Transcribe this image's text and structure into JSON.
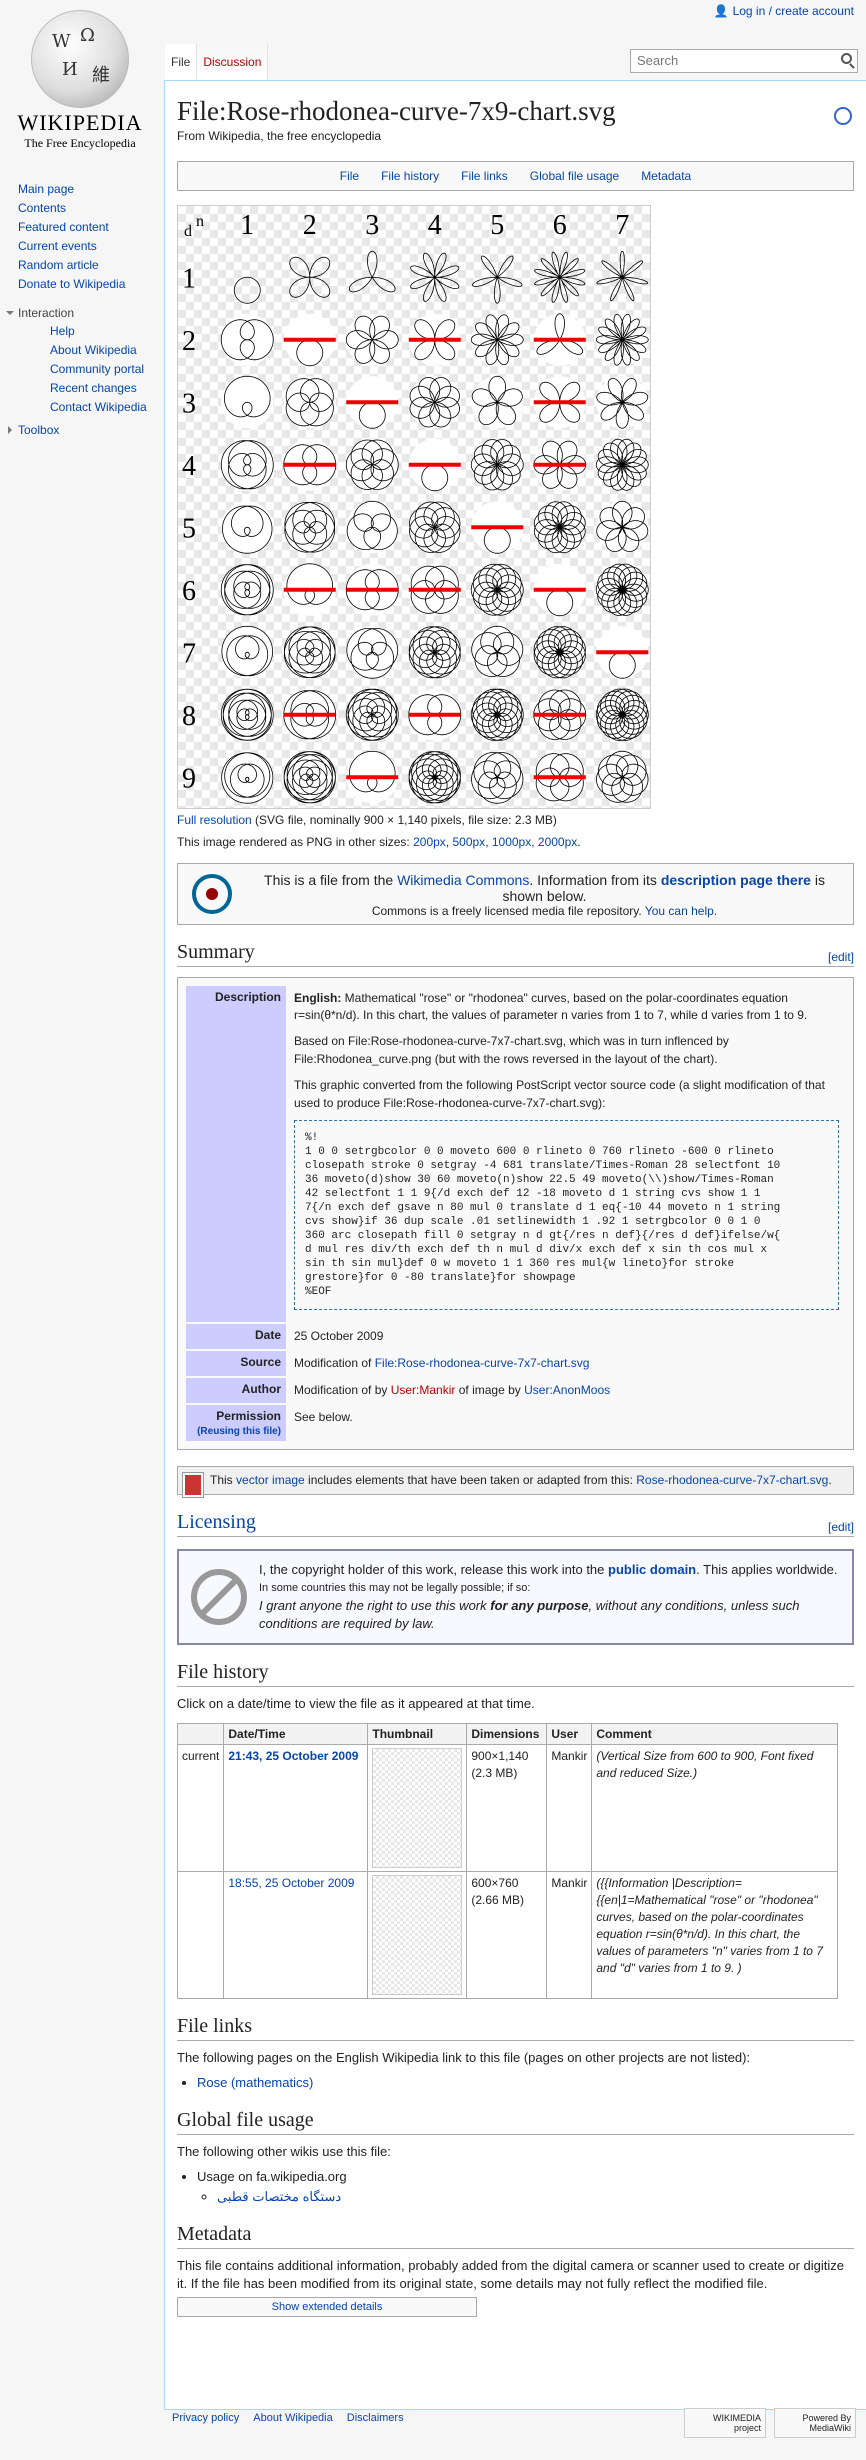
{
  "header": {
    "login": "Log in / create account",
    "search_placeholder": "Search",
    "tabs": [
      "File",
      "Discussion"
    ]
  },
  "logo": {
    "wordmark": "WIKIPEDIA",
    "tagline": "The Free Encyclopedia"
  },
  "sidebar": {
    "main": [
      "Main page",
      "Contents",
      "Featured content",
      "Current events",
      "Random article",
      "Donate to Wikipedia"
    ],
    "interaction_heading": "Interaction",
    "interaction": [
      "Help",
      "About Wikipedia",
      "Community portal",
      "Recent changes",
      "Contact Wikipedia"
    ],
    "toolbox": "Toolbox"
  },
  "page": {
    "title": "File:Rose-rhodonea-curve-7x9-chart.svg",
    "subtitle": "From Wikipedia, the free encyclopedia"
  },
  "filetoc": [
    "File",
    "File history",
    "File links",
    "Global file usage",
    "Metadata"
  ],
  "image": {
    "n_label": "n",
    "d_label": "d",
    "n_values": [
      "1",
      "2",
      "3",
      "4",
      "5",
      "6",
      "7"
    ],
    "d_values": [
      "1",
      "2",
      "3",
      "4",
      "5",
      "6",
      "7",
      "8",
      "9"
    ]
  },
  "fullres": {
    "link": "Full resolution",
    "details": " (SVG file, nominally 900 × 1,140 pixels, file size: 2.3 MB)"
  },
  "other_sizes": {
    "text": "This image rendered as PNG in other sizes: ",
    "sizes": [
      "200px",
      "500px",
      "1000px",
      "2000px"
    ]
  },
  "commons": {
    "line1a": "This is a file from the ",
    "line1b": "Wikimedia Commons",
    "line1c": ". Information from its ",
    "line1d": "description page there",
    "line1e": " is shown below.",
    "line2a": "Commons is a freely licensed media file repository. ",
    "line2b": "You can help."
  },
  "summary": {
    "heading": "Summary",
    "edit": "[edit]",
    "desc_label": "Description",
    "desc_en": "English:",
    "desc_text": " Mathematical \"rose\" or \"rhodonea\" curves, based on the polar-coordinates equation r=sin(θ*n/d). In this chart, the values of parameter n varies from 1 to 7, while d varies from 1 to 9.",
    "based": "Based on File:Rose-rhodonea-curve-7x7-chart.svg, which was in turn inflenced by File:Rhodonea_curve.png (but with the rows reversed in the layout of the chart).",
    "converted": "This graphic converted from the following PostScript vector source code (a slight modification of that used to produce File:Rose-rhodonea-curve-7x7-chart.svg):",
    "code": "%!\n1 0 0 setrgbcolor 0 0 moveto 600 0 rlineto 0 760 rlineto -600 0 rlineto\nclosepath stroke 0 setgray -4 681 translate/Times-Roman 28 selectfont 10\n36 moveto(d)show 30 60 moveto(n)show 22.5 49 moveto(\\\\)show/Times-Roman\n42 selectfont 1 1 9{/d exch def 12 -18 moveto d 1 string cvs show 1 1\n7{/n exch def gsave n 80 mul 0 translate d 1 eq{-10 44 moveto n 1 string\ncvs show}if 36 dup scale .01 setlinewidth 1 .92 1 setrgbcolor 0 0 1 0\n360 arc closepath fill 0 setgray n d gt{/res n def}{/res d def}ifelse/w{\nd mul res div/th exch def th n mul d div/x exch def x sin th cos mul x\nsin th sin mul}def 0 w moveto 1 1 360 res mul{w lineto}for stroke\ngrestore}for 0 -80 translate}for showpage\n%EOF",
    "date_label": "Date",
    "date": "25 October 2009",
    "source_label": "Source",
    "source_a": "Modification of ",
    "source_b": "File:Rose-rhodonea-curve-7x7-chart.svg",
    "author_label": "Author",
    "author_a": "Modification of by ",
    "author_b": "User:Mankir",
    "author_c": " of image by ",
    "author_d": "User:AnonMoos",
    "perm_label": "Permission",
    "perm_sub": "(Reusing this file)",
    "perm": "See below."
  },
  "vector_note": {
    "a": "This ",
    "b": "vector image",
    "c": " includes elements that have been taken or adapted from this: ",
    "d": "Rose-rhodonea-curve-7x7-chart.svg",
    "e": "."
  },
  "licensing": {
    "heading": "Licensing",
    "edit": "[edit]",
    "l1a": "I, the copyright holder of this work, release this work into the ",
    "l1b": "public domain",
    "l1c": ". This applies worldwide.",
    "l2": "In some countries this may not be legally possible; if so:",
    "l3a": "I grant anyone the right to use this work ",
    "l3b": "for any purpose",
    "l3c": ", without any conditions, unless such conditions are required by law."
  },
  "history": {
    "heading": "File history",
    "intro": "Click on a date/time to view the file as it appeared at that time.",
    "cols": [
      "",
      "Date/Time",
      "Thumbnail",
      "Dimensions",
      "User",
      "Comment"
    ],
    "rows": [
      {
        "status": "current",
        "date": "21:43, 25 October 2009",
        "dims": "900×1,140",
        "size": "(2.3 MB)",
        "user": "Mankir",
        "comment": "(Vertical Size from 600 to 900, Font fixed and reduced Size.)"
      },
      {
        "status": "",
        "date": "18:55, 25 October 2009",
        "dims": "600×760",
        "size": "(2.66 MB)",
        "user": "Mankir",
        "comment": "({{Information |Description={{en|1=Mathematical \"rose\" or \"rhodonea\" curves, based on the polar-coordinates equation r=sin(θ*n/d). In this chart, the values of parameters \"n\" varies from 1 to 7 and \"d\" varies from 1 to 9. )"
      }
    ]
  },
  "filelinks": {
    "heading": "File links",
    "intro": "The following pages on the English Wikipedia link to this file (pages on other projects are not listed):",
    "items": [
      "Rose (mathematics)"
    ]
  },
  "global": {
    "heading": "Global file usage",
    "intro": "The following other wikis use this file:",
    "wiki": "Usage on fa.wikipedia.org",
    "page": "دستگاه مختصات قطبی"
  },
  "metadata": {
    "heading": "Metadata",
    "text": "This file contains additional information, probably added from the digital camera or scanner used to create or digitize it. If the file has been modified from its original state, some details may not fully reflect the modified file.",
    "button": "Show extended details"
  },
  "footer": {
    "links": [
      "Privacy policy",
      "About Wikipedia",
      "Disclaimers"
    ],
    "badge1": "WIKIMEDIA project",
    "badge2": "Powered By MediaWiki"
  }
}
